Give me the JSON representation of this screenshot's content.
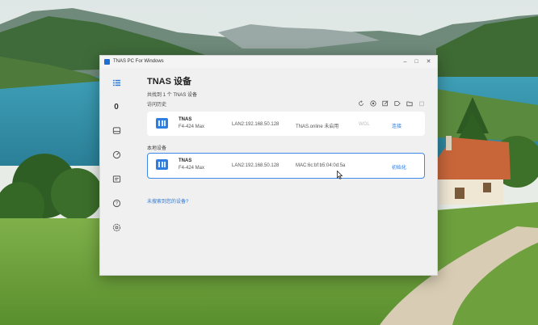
{
  "window": {
    "title": "TNAS PC For Windows",
    "controls": {
      "minimize": "–",
      "maximize": "□",
      "close": "✕"
    }
  },
  "sidebar": {
    "items": [
      {
        "icon": "list-icon"
      },
      {
        "icon": "zero-icon",
        "glyph": "0"
      },
      {
        "icon": "drive-icon"
      },
      {
        "icon": "gauge-icon"
      },
      {
        "icon": "message-icon"
      },
      {
        "icon": "help-icon"
      },
      {
        "icon": "settings-icon"
      }
    ]
  },
  "main": {
    "title": "TNAS 设备",
    "found_text": "共找到 1 个 TNAS 设备",
    "history_label": "访问历史",
    "local_label": "本地设备",
    "not_found_link": "未搜索到您的设备?",
    "toolbar_icons": [
      "refresh-icon",
      "add-icon",
      "edit-icon",
      "tag-icon",
      "folder-icon",
      "delete-icon"
    ]
  },
  "history_device": {
    "name": "TNAS",
    "model": "F4-424 Max",
    "lan": "LAN2:192.168.50.128",
    "info": "TNAS.online 未启用",
    "wol": "WOL",
    "action": "连接"
  },
  "local_device": {
    "name": "TNAS",
    "model": "F4-424 Max",
    "lan": "LAN2:192.168.50.128",
    "info": "MAC:6c:bf:b5:04:0d:5a",
    "action": "初始化"
  },
  "colors": {
    "accent": "#2e7ad6",
    "selected_border": "#3d8be8",
    "window_bg": "#f0f0f0"
  }
}
